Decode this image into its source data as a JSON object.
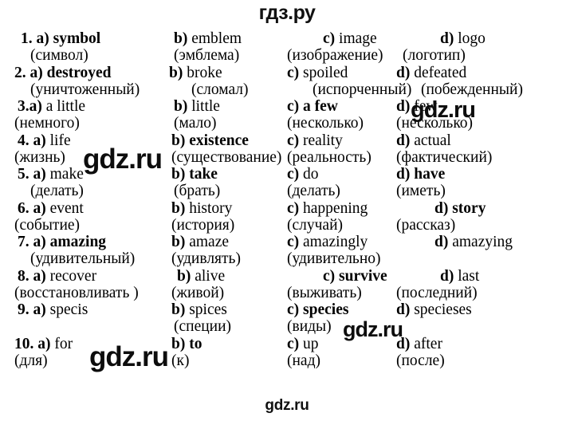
{
  "header": {
    "title": "гдз.ру"
  },
  "footer": {
    "title": "gdz.ru"
  },
  "watermarks": [
    {
      "text": "gdz.ru"
    },
    {
      "text": "gdz.ru"
    },
    {
      "text": "gdz.ru"
    },
    {
      "text": "gdz.ru"
    }
  ],
  "quiz": {
    "rows": [
      {
        "number": "1.",
        "options": [
          {
            "letter": "a)",
            "word": "symbol",
            "bold": true,
            "translation": "(символ)"
          },
          {
            "letter": "b)",
            "word": "emblem",
            "bold": false,
            "translation": "(эмблема)"
          },
          {
            "letter": "c)",
            "word": "image",
            "bold": false,
            "translation": "(изображение)"
          },
          {
            "letter": "d)",
            "word": "logo",
            "bold": false,
            "translation": "(логотип)"
          }
        ]
      },
      {
        "number": "2.",
        "options": [
          {
            "letter": "a)",
            "word": "destroyed",
            "bold": true,
            "translation": "(уничтоженный)"
          },
          {
            "letter": "b)",
            "word": "broke",
            "bold": false,
            "translation": "(сломал)"
          },
          {
            "letter": "c)",
            "word": "spoiled",
            "bold": false,
            "translation": "(испорченный)"
          },
          {
            "letter": "d)",
            "word": "defeated",
            "bold": false,
            "translation": "(побежденный)"
          }
        ]
      },
      {
        "number": "3.",
        "options": [
          {
            "letter": "a)",
            "word": "a little",
            "bold": false,
            "translation": "(немного)"
          },
          {
            "letter": "b)",
            "word": "little",
            "bold": false,
            "translation": "(мало)"
          },
          {
            "letter": "c)",
            "word": "a few",
            "bold": true,
            "translation": "(несколько)"
          },
          {
            "letter": "d)",
            "word": "few",
            "bold": false,
            "translation": "(несколько)"
          }
        ]
      },
      {
        "number": "4.",
        "options": [
          {
            "letter": "a)",
            "word": "life",
            "bold": false,
            "translation": "(жизнь)"
          },
          {
            "letter": "b)",
            "word": "existence",
            "bold": true,
            "translation": "(существование)"
          },
          {
            "letter": "c)",
            "word": "reality",
            "bold": false,
            "translation": "(реальность)"
          },
          {
            "letter": "d)",
            "word": "actual",
            "bold": false,
            "translation": "(фактический)"
          }
        ]
      },
      {
        "number": "5.",
        "options": [
          {
            "letter": "a)",
            "word": "make",
            "bold": false,
            "translation": "(делать)"
          },
          {
            "letter": "b)",
            "word": "take",
            "bold": true,
            "translation": "(брать)"
          },
          {
            "letter": "c)",
            "word": "do",
            "bold": false,
            "translation": "(делать)"
          },
          {
            "letter": "d)",
            "word": "have",
            "bold": true,
            "translation": "(иметь)"
          }
        ]
      },
      {
        "number": "6.",
        "options": [
          {
            "letter": "a)",
            "word": "event",
            "bold": false,
            "translation": "(событие)"
          },
          {
            "letter": "b)",
            "word": "history",
            "bold": false,
            "translation": "(история)"
          },
          {
            "letter": "c)",
            "word": "happening",
            "bold": false,
            "translation": "(случай)"
          },
          {
            "letter": "d)",
            "word": "story",
            "bold": true,
            "translation": "(рассказ)"
          }
        ]
      },
      {
        "number": "7.",
        "options": [
          {
            "letter": "a)",
            "word": "amazing",
            "bold": true,
            "translation": "(удивительный)"
          },
          {
            "letter": "b)",
            "word": "amaze",
            "bold": false,
            "translation": "(удивлять)"
          },
          {
            "letter": "c)",
            "word": "amazingly",
            "bold": false,
            "translation": "(удивительно)"
          },
          {
            "letter": "d)",
            "word": "amazying",
            "bold": false,
            "translation": ""
          }
        ]
      },
      {
        "number": "8.",
        "options": [
          {
            "letter": "a)",
            "word": "recover",
            "bold": false,
            "translation": "(восстановливать )"
          },
          {
            "letter": "b)",
            "word": "alive",
            "bold": false,
            "translation": "(живой)"
          },
          {
            "letter": "c)",
            "word": "survive",
            "bold": true,
            "translation": "(выживать)"
          },
          {
            "letter": "d)",
            "word": "last",
            "bold": false,
            "translation": "(последний)"
          }
        ]
      },
      {
        "number": "9.",
        "options": [
          {
            "letter": "a)",
            "word": "specis",
            "bold": false,
            "translation": ""
          },
          {
            "letter": "b)",
            "word": "spices",
            "bold": false,
            "translation": "(специи)"
          },
          {
            "letter": "c)",
            "word": "species",
            "bold": true,
            "translation": "(виды)"
          },
          {
            "letter": "d)",
            "word": "specieses",
            "bold": false,
            "translation": ""
          }
        ]
      },
      {
        "number": "10.",
        "options": [
          {
            "letter": "a)",
            "word": "for",
            "bold": false,
            "translation": "(для)"
          },
          {
            "letter": "b)",
            "word": "to",
            "bold": true,
            "translation": "(к)"
          },
          {
            "letter": "c)",
            "word": "up",
            "bold": false,
            "translation": "(над)"
          },
          {
            "letter": "d)",
            "word": "after",
            "bold": false,
            "translation": "(после)"
          }
        ]
      }
    ]
  }
}
